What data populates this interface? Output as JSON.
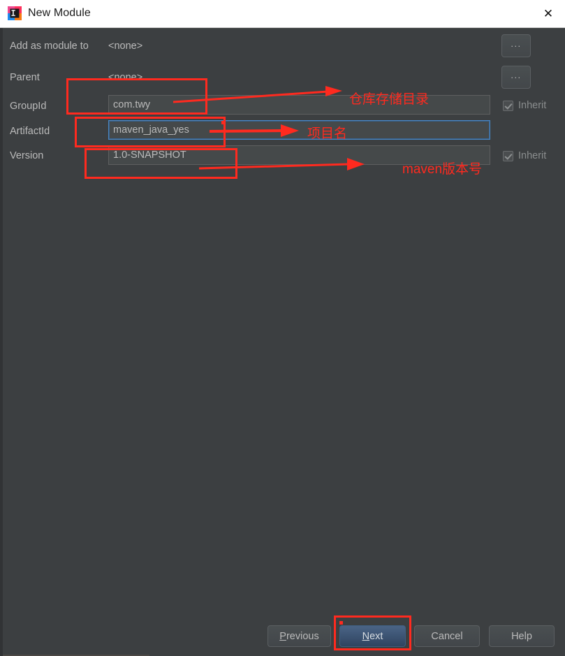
{
  "window": {
    "title": "New Module",
    "app_icon": "intellij-idea-icon",
    "close_icon": "close-icon"
  },
  "form": {
    "add_as_module_to": {
      "label": "Add as module to",
      "value": "<none>"
    },
    "parent": {
      "label": "Parent",
      "value": "<none>"
    },
    "group_id": {
      "label": "GroupId",
      "value": "com.twy"
    },
    "artifact_id": {
      "label": "ArtifactId",
      "value": "maven_java_yes"
    },
    "version": {
      "label": "Version",
      "value": "1.0-SNAPSHOT"
    },
    "browse_button_label": "...",
    "inherit_label": "Inherit"
  },
  "buttons": {
    "previous": "Previous",
    "previous_mnemonic": "P",
    "previous_rest": "revious",
    "next": "Next",
    "next_mnemonic": "N",
    "next_rest": "ext",
    "cancel": "Cancel",
    "help": "Help"
  },
  "annotations": {
    "group_id_note": "仓库存储目录",
    "artifact_id_note": "项目名",
    "version_note": "maven版本号"
  },
  "colors": {
    "annotation_red": "#ff2a1f",
    "dialog_background": "#3c3f41",
    "titlebar_background": "#ffffff",
    "focus_blue": "#4b87c4",
    "default_button_blue": "#2f4460"
  }
}
